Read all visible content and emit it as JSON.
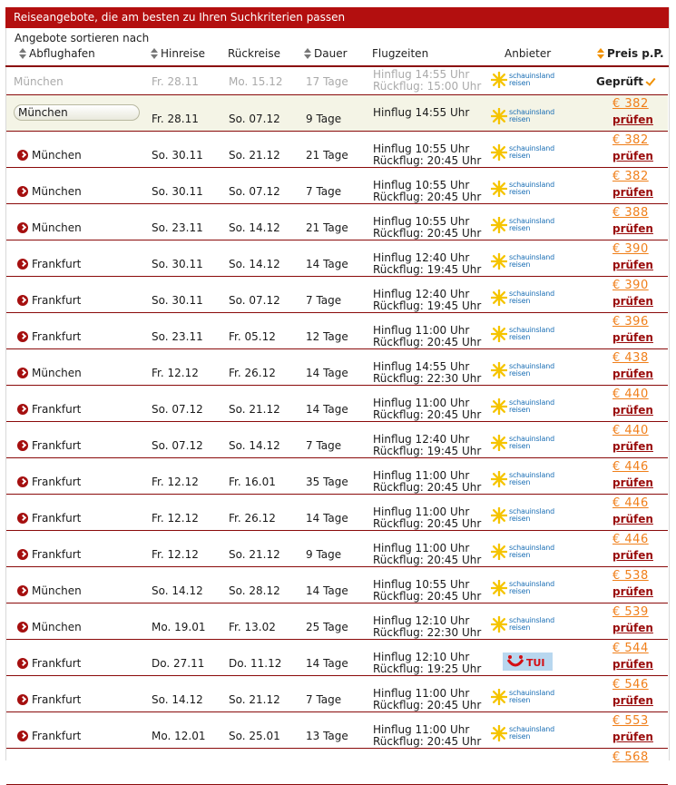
{
  "title": "Reiseangebote, die am besten zu Ihren Suchkriterien passen",
  "sort_caption": "Angebote sortieren nach",
  "headers": {
    "departure": "Abflughafen",
    "outbound": "Hinreise",
    "return": "Rückreise",
    "duration": "Dauer",
    "flights": "Flugzeiten",
    "provider": "Anbieter",
    "price": "Preis p.P."
  },
  "reference": {
    "departure": "München",
    "outbound": "Fr. 28.11",
    "return": "Mo. 15.12",
    "duration": "17 Tage",
    "flight_out": "Hinflug 14:55 Uhr",
    "flight_back": "Rückflug: 15:00 Uhr",
    "provider": "schauinsland reisen",
    "status": "Geprüft"
  },
  "check_label": "prüfen",
  "offers": [
    {
      "departure": "München",
      "outbound": "Fr. 28.11",
      "return": "So. 07.12",
      "duration": "9 Tage",
      "flight_out": "Hinflug 14:55 Uhr",
      "flight_back": "",
      "provider": "schauinsland",
      "price": "€ 382",
      "selected": true
    },
    {
      "departure": "München",
      "outbound": "So. 30.11",
      "return": "So. 21.12",
      "duration": "21 Tage",
      "flight_out": "Hinflug 10:55 Uhr",
      "flight_back": "Rückflug: 20:45 Uhr",
      "provider": "schauinsland",
      "price": "€ 382"
    },
    {
      "departure": "München",
      "outbound": "So. 30.11",
      "return": "So. 07.12",
      "duration": "7 Tage",
      "flight_out": "Hinflug 10:55 Uhr",
      "flight_back": "Rückflug: 20:45 Uhr",
      "provider": "schauinsland",
      "price": "€ 382"
    },
    {
      "departure": "München",
      "outbound": "So. 23.11",
      "return": "So. 14.12",
      "duration": "21 Tage",
      "flight_out": "Hinflug 10:55 Uhr",
      "flight_back": "Rückflug: 20:45 Uhr",
      "provider": "schauinsland",
      "price": "€ 388"
    },
    {
      "departure": "Frankfurt",
      "outbound": "So. 30.11",
      "return": "So. 14.12",
      "duration": "14 Tage",
      "flight_out": "Hinflug 12:40 Uhr",
      "flight_back": "Rückflug: 19:45 Uhr",
      "provider": "schauinsland",
      "price": "€ 390"
    },
    {
      "departure": "Frankfurt",
      "outbound": "So. 30.11",
      "return": "So. 07.12",
      "duration": "7 Tage",
      "flight_out": "Hinflug 12:40 Uhr",
      "flight_back": "Rückflug: 19:45 Uhr",
      "provider": "schauinsland",
      "price": "€ 390"
    },
    {
      "departure": "Frankfurt",
      "outbound": "So. 23.11",
      "return": "Fr. 05.12",
      "duration": "12 Tage",
      "flight_out": "Hinflug 11:00 Uhr",
      "flight_back": "Rückflug: 20:45 Uhr",
      "provider": "schauinsland",
      "price": "€ 396"
    },
    {
      "departure": "München",
      "outbound": "Fr. 12.12",
      "return": "Fr. 26.12",
      "duration": "14 Tage",
      "flight_out": "Hinflug 14:55 Uhr",
      "flight_back": "Rückflug: 22:30 Uhr",
      "provider": "schauinsland",
      "price": "€ 438"
    },
    {
      "departure": "Frankfurt",
      "outbound": "So. 07.12",
      "return": "So. 21.12",
      "duration": "14 Tage",
      "flight_out": "Hinflug 11:00 Uhr",
      "flight_back": "Rückflug: 20:45 Uhr",
      "provider": "schauinsland",
      "price": "€ 440"
    },
    {
      "departure": "Frankfurt",
      "outbound": "So. 07.12",
      "return": "So. 14.12",
      "duration": "7 Tage",
      "flight_out": "Hinflug 12:40 Uhr",
      "flight_back": "Rückflug: 19:45 Uhr",
      "provider": "schauinsland",
      "price": "€ 440"
    },
    {
      "departure": "Frankfurt",
      "outbound": "Fr. 12.12",
      "return": "Fr. 16.01",
      "duration": "35 Tage",
      "flight_out": "Hinflug 11:00 Uhr",
      "flight_back": "Rückflug: 20:45 Uhr",
      "provider": "schauinsland",
      "price": "€ 446"
    },
    {
      "departure": "Frankfurt",
      "outbound": "Fr. 12.12",
      "return": "Fr. 26.12",
      "duration": "14 Tage",
      "flight_out": "Hinflug 11:00 Uhr",
      "flight_back": "Rückflug: 20:45 Uhr",
      "provider": "schauinsland",
      "price": "€ 446"
    },
    {
      "departure": "Frankfurt",
      "outbound": "Fr. 12.12",
      "return": "So. 21.12",
      "duration": "9 Tage",
      "flight_out": "Hinflug 11:00 Uhr",
      "flight_back": "Rückflug: 20:45 Uhr",
      "provider": "schauinsland",
      "price": "€ 446"
    },
    {
      "departure": "München",
      "outbound": "So. 14.12",
      "return": "So. 28.12",
      "duration": "14 Tage",
      "flight_out": "Hinflug 10:55 Uhr",
      "flight_back": "Rückflug: 20:45 Uhr",
      "provider": "schauinsland",
      "price": "€ 538"
    },
    {
      "departure": "München",
      "outbound": "Mo. 19.01",
      "return": "Fr. 13.02",
      "duration": "25 Tage",
      "flight_out": "Hinflug 12:10 Uhr",
      "flight_back": "Rückflug: 22:30 Uhr",
      "provider": "schauinsland",
      "price": "€ 539"
    },
    {
      "departure": "Frankfurt",
      "outbound": "Do. 27.11",
      "return": "Do. 11.12",
      "duration": "14 Tage",
      "flight_out": "Hinflug 12:10 Uhr",
      "flight_back": "Rückflug: 19:25 Uhr",
      "provider": "tui",
      "price": "€ 544"
    },
    {
      "departure": "Frankfurt",
      "outbound": "So. 14.12",
      "return": "So. 21.12",
      "duration": "7 Tage",
      "flight_out": "Hinflug 11:00 Uhr",
      "flight_back": "Rückflug: 20:45 Uhr",
      "provider": "schauinsland",
      "price": "€ 546"
    },
    {
      "departure": "Frankfurt",
      "outbound": "Mo. 12.01",
      "return": "So. 25.01",
      "duration": "13 Tage",
      "flight_out": "Hinflug 11:00 Uhr",
      "flight_back": "Rückflug: 20:45 Uhr",
      "provider": "schauinsland",
      "price": "€ 553"
    },
    {
      "departure": "",
      "outbound": "",
      "return": "",
      "duration": "",
      "flight_out": "",
      "flight_back": "",
      "provider": "",
      "price": "€ 568",
      "partial": true
    }
  ],
  "provider_logos": {
    "schauinsland": {
      "line1": "schauinsland",
      "line2": "reisen",
      "color": "#1b6fb5",
      "sun_color": "#f5c400"
    },
    "tui": {
      "text": "TUI",
      "color": "#d40e14",
      "bg": "#b8d7ef"
    }
  },
  "colors": {
    "accent": "#b30f0f",
    "price": "#f07f1a",
    "row_line": "#8a0a0a"
  }
}
